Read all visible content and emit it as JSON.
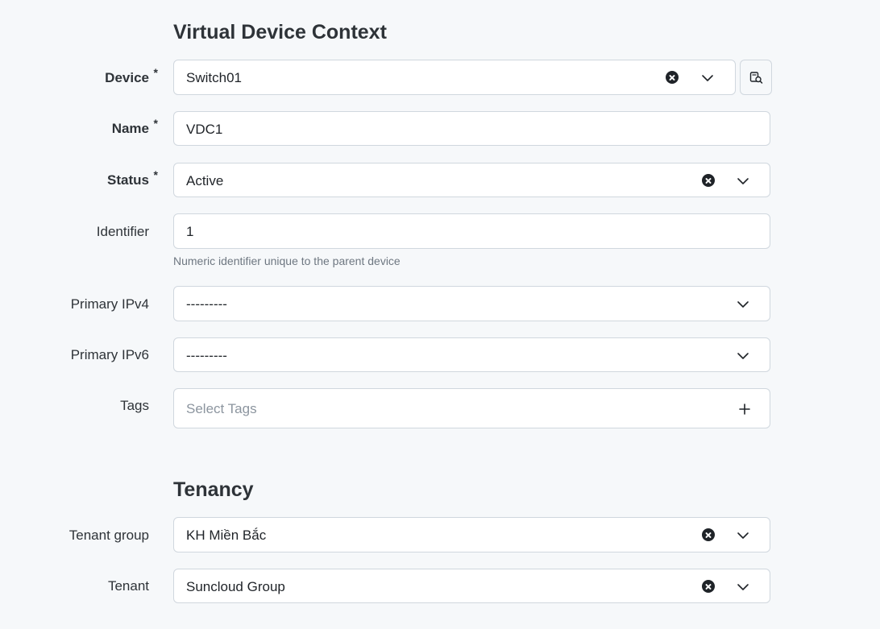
{
  "sections": {
    "vdc_title": "Virtual Device Context",
    "tenancy_title": "Tenancy"
  },
  "fields": {
    "device": {
      "label": "Device",
      "required_mark": "*",
      "value": "Switch01"
    },
    "name": {
      "label": "Name",
      "required_mark": "*",
      "value": "VDC1"
    },
    "status": {
      "label": "Status",
      "required_mark": "*",
      "value": "Active"
    },
    "identifier": {
      "label": "Identifier",
      "value": "1",
      "help": "Numeric identifier unique to the parent device"
    },
    "primary_ipv4": {
      "label": "Primary IPv4",
      "value": "---------"
    },
    "primary_ipv6": {
      "label": "Primary IPv6",
      "value": "---------"
    },
    "tags": {
      "label": "Tags",
      "placeholder": "Select Tags"
    },
    "tenant_group": {
      "label": "Tenant group",
      "value": "KH Miền Bắc"
    },
    "tenant": {
      "label": "Tenant",
      "value": "Suncloud Group"
    }
  },
  "icons": {
    "clear": "clear-icon",
    "chevron": "chevron-down-icon",
    "plus": "plus-icon",
    "selector": "selector-search-icon"
  },
  "colors": {
    "background": "#f6f8fa",
    "field_bg": "#ffffff",
    "border": "#d0d7de",
    "text": "#1f2328",
    "muted": "#6e7781"
  }
}
